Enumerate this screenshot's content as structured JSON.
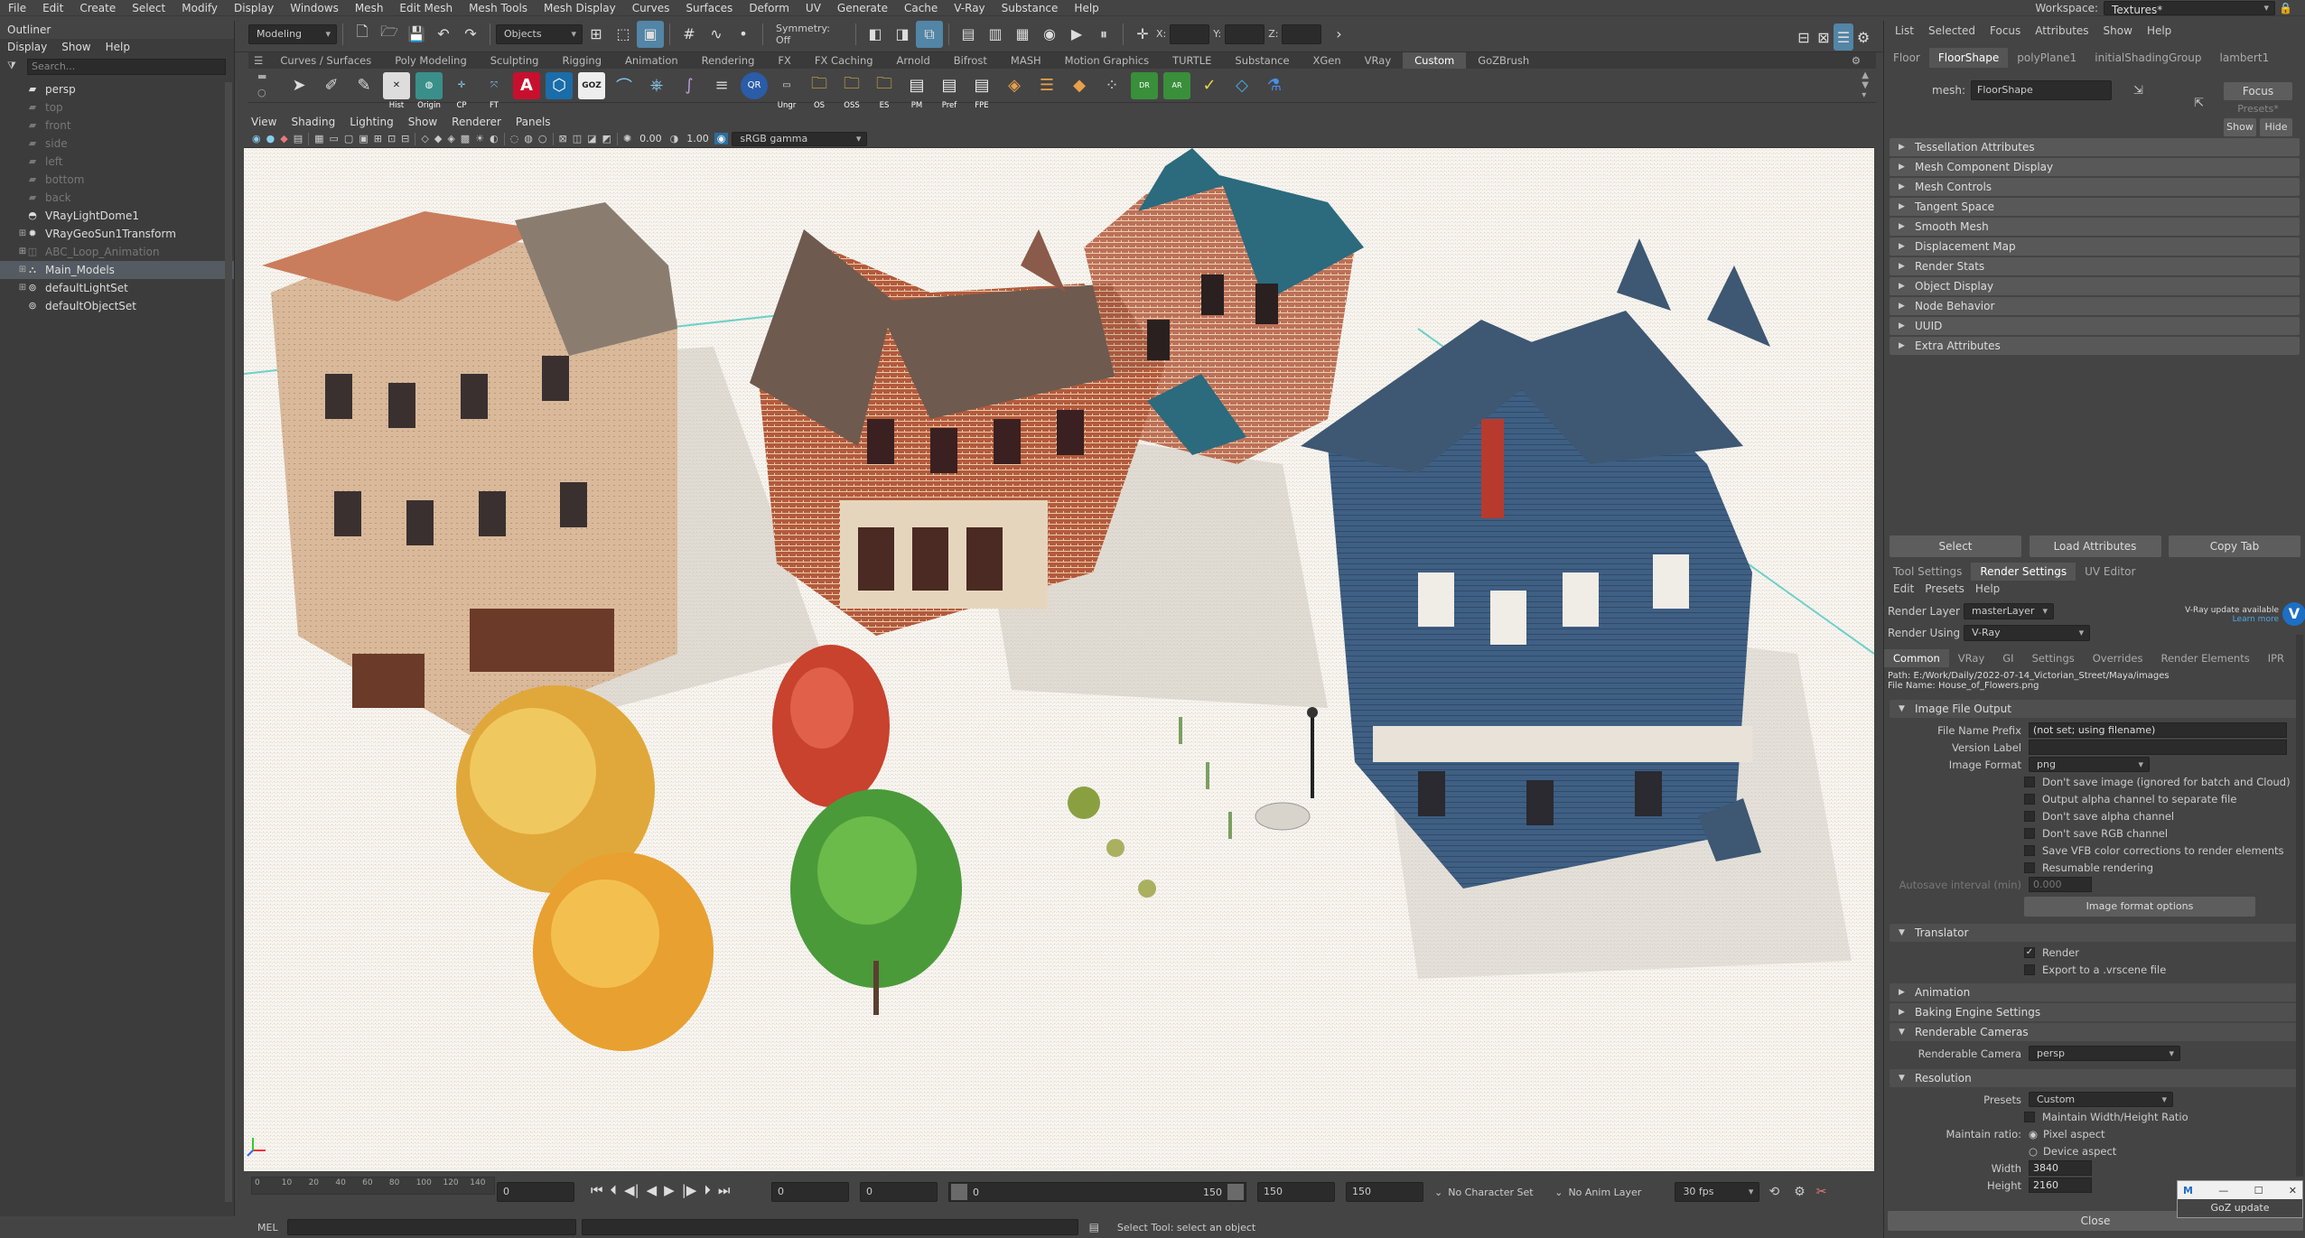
{
  "menubar": {
    "items": [
      "File",
      "Edit",
      "Create",
      "Select",
      "Modify",
      "Display",
      "Windows",
      "Mesh",
      "Edit Mesh",
      "Mesh Tools",
      "Mesh Display",
      "Curves",
      "Surfaces",
      "Deform",
      "UV",
      "Generate",
      "Cache",
      "V-Ray",
      "Substance",
      "Help"
    ],
    "workspace_label": "Workspace:",
    "workspace_value": "Textures*"
  },
  "statusline": {
    "menuset": "Modeling",
    "selection_mask": "Objects",
    "symmetry": "Symmetry: Off",
    "x_label": "X:",
    "y_label": "Y:",
    "z_label": "Z:"
  },
  "shelf": {
    "tabs": [
      "Curves / Surfaces",
      "Poly Modeling",
      "Sculpting",
      "Rigging",
      "Animation",
      "Rendering",
      "FX",
      "FX Caching",
      "Arnold",
      "Bifrost",
      "MASH",
      "Motion Graphics",
      "TURTLE",
      "Substance",
      "XGen",
      "VRay",
      "Custom",
      "GoZBrush"
    ],
    "active_tab": "Custom",
    "icon_labels": [
      "Hist",
      "Origin",
      "CP",
      "FT",
      "Ungr",
      "OS",
      "OSS",
      "ES",
      "PM",
      "Pref",
      "FPE",
      "QR"
    ]
  },
  "outliner": {
    "title": "Outliner",
    "menu": [
      "Display",
      "Show",
      "Help"
    ],
    "search_placeholder": "Search...",
    "items": [
      {
        "label": "persp",
        "dim": false
      },
      {
        "label": "top",
        "dim": true
      },
      {
        "label": "front",
        "dim": true
      },
      {
        "label": "side",
        "dim": true
      },
      {
        "label": "left",
        "dim": true
      },
      {
        "label": "bottom",
        "dim": true
      },
      {
        "label": "back",
        "dim": true
      },
      {
        "label": "VRayLightDome1",
        "dim": false
      },
      {
        "label": "VRayGeoSun1Transform",
        "dim": false
      },
      {
        "label": "ABC_Loop_Animation",
        "dim": true
      },
      {
        "label": "Main_Models",
        "dim": false
      },
      {
        "label": "defaultLightSet",
        "dim": false
      },
      {
        "label": "defaultObjectSet",
        "dim": false
      }
    ]
  },
  "viewport": {
    "menu": [
      "View",
      "Shading",
      "Lighting",
      "Show",
      "Renderer",
      "Panels"
    ],
    "exposure": "0.00",
    "gamma": "1.00",
    "color_space": "sRGB gamma"
  },
  "timeslider": {
    "ticks": [
      "0",
      "10",
      "20",
      "40",
      "60",
      "80",
      "100",
      "120",
      "140"
    ],
    "current_frame": "0",
    "range_start": "0",
    "playback_start": "0",
    "range_slider_start": "0",
    "range_slider_end": "150",
    "playback_end": "150",
    "anim_end": "150",
    "character_set": "No Character Set",
    "anim_layer": "No Anim Layer",
    "fps": "30 fps"
  },
  "cmdline": {
    "label": "MEL",
    "help_text": "Select Tool: select an object"
  },
  "attribute_editor": {
    "menu": [
      "List",
      "Selected",
      "Focus",
      "Attributes",
      "Show",
      "Help"
    ],
    "tabs": [
      "Floor",
      "FloorShape",
      "polyPlane1",
      "initialShadingGroup",
      "lambert1"
    ],
    "active_tab": "FloorShape",
    "mesh_label": "mesh:",
    "mesh_value": "FloorShape",
    "focus_btn": "Focus",
    "presets_btn": "Presets*",
    "show_btn": "Show",
    "hide_btn": "Hide",
    "sections": [
      "Tessellation Attributes",
      "Mesh Component Display",
      "Mesh Controls",
      "Tangent Space",
      "Smooth Mesh",
      "Displacement Map",
      "Render Stats",
      "Object Display",
      "Node Behavior",
      "UUID",
      "Extra Attributes"
    ],
    "select_btn": "Select",
    "load_btn": "Load Attributes",
    "copy_btn": "Copy Tab"
  },
  "render_settings": {
    "tabs": [
      "Tool Settings",
      "Render Settings",
      "UV Editor"
    ],
    "active_tab": "Render Settings",
    "menu": [
      "Edit",
      "Presets",
      "Help"
    ],
    "render_layer_label": "Render Layer",
    "render_layer": "masterLayer",
    "render_using_label": "Render Using",
    "render_using": "V-Ray",
    "update_notice": "V-Ray update available",
    "learn_more": "Learn more",
    "sub_tabs": [
      "Common",
      "VRay",
      "GI",
      "Settings",
      "Overrides",
      "Render Elements",
      "IPR"
    ],
    "active_sub_tab": "Common",
    "path": "Path: E:/Work/Daily/2022-07-14_Victorian_Street/Maya/images",
    "file_name": "File Name: House_of_Flowers.png",
    "image_file_output": "Image File Output",
    "file_name_prefix_label": "File Name Prefix",
    "file_name_prefix": "(not set; using filename)",
    "version_label_label": "Version Label",
    "image_format_label": "Image Format",
    "image_format": "png",
    "checks": [
      {
        "label": "Don't save image (ignored for batch and Cloud)",
        "checked": false
      },
      {
        "label": "Output alpha channel to separate file",
        "checked": false
      },
      {
        "label": "Don't save alpha channel",
        "checked": false
      },
      {
        "label": "Don't save RGB channel",
        "checked": false
      },
      {
        "label": "Save VFB color corrections to render elements",
        "checked": false
      },
      {
        "label": "Resumable rendering",
        "checked": false
      }
    ],
    "autosave_label": "Autosave interval (min)",
    "autosave_value": "0.000",
    "image_format_options": "Image format options",
    "translator": "Translator",
    "render_check": "Render",
    "export_check": "Export to a .vrscene file",
    "animation": "Animation",
    "baking": "Baking Engine Settings",
    "renderable_cameras": "Renderable Cameras",
    "renderable_camera_label": "Renderable Camera",
    "renderable_camera": "persp",
    "resolution": "Resolution",
    "presets_label": "Presets",
    "presets_value": "Custom",
    "maintain_wh": "Maintain Width/Height Ratio",
    "maintain_ratio_label": "Maintain ratio:",
    "pixel_aspect": "Pixel aspect",
    "device_aspect": "Device aspect",
    "width_label": "Width",
    "width": "3840",
    "height_label": "Height",
    "height": "2160",
    "close_btn": "Close"
  },
  "goz": {
    "label": "GoZ update"
  },
  "colors": {
    "accent": "#5285a6",
    "vray_blue": "#1d6fc4",
    "viewport_bg": "#f6f3ef"
  }
}
